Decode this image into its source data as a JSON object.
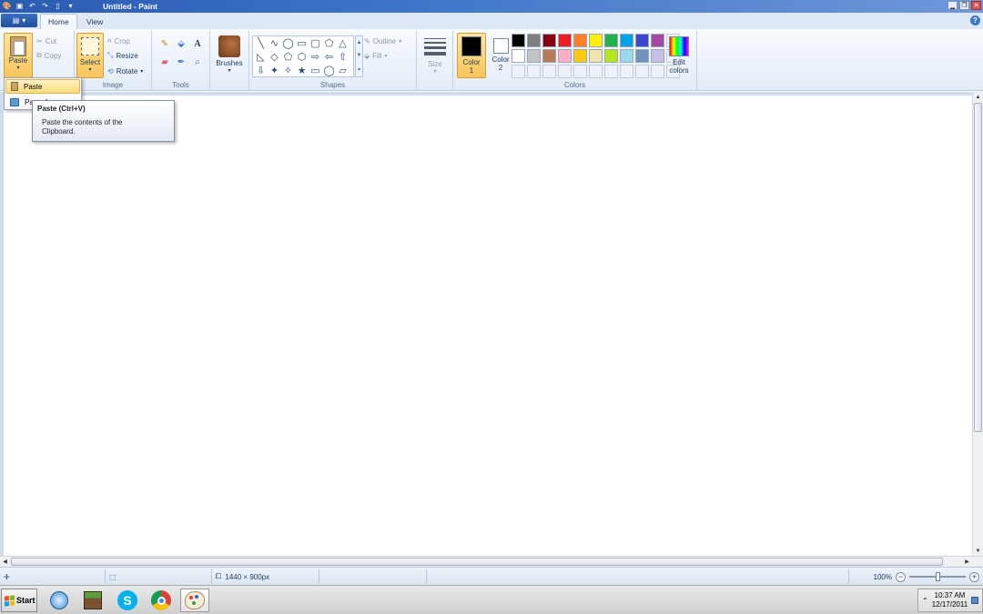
{
  "window": {
    "title": "Untitled - Paint",
    "controls": {
      "minimize": "▁",
      "restore": "❐",
      "close": "✕"
    }
  },
  "tabs": [
    {
      "label": "Home"
    },
    {
      "label": "View"
    }
  ],
  "help_label": "?",
  "ribbon": {
    "clipboard": {
      "paste": "Paste",
      "cut": "Cut",
      "copy": "Copy"
    },
    "image": {
      "label": "Image",
      "select": "Select",
      "crop": "Crop",
      "resize": "Resize",
      "rotate": "Rotate"
    },
    "tools": {
      "label": "Tools"
    },
    "brushes": {
      "label": "Brushes"
    },
    "shapes": {
      "label": "Shapes",
      "glyphs": [
        "╲",
        "∿",
        "◯",
        "▭",
        "▢",
        "⬠",
        "△",
        "◺",
        "◇",
        "⬠",
        "⬡",
        "⇨",
        "⇦",
        "⇧",
        "⇩",
        "✦",
        "✧",
        "★",
        "▭",
        "◯",
        "▱"
      ],
      "outline": "Outline",
      "fill": "Fill"
    },
    "size": {
      "label": "Size"
    },
    "colors": {
      "label": "Colors",
      "color1": {
        "line1": "Color",
        "line2": "1",
        "value": "#000000"
      },
      "color2": {
        "line1": "Color",
        "line2": "2",
        "value": "#ffffff"
      },
      "edit": {
        "line1": "Edit",
        "line2": "colors"
      },
      "palette_row1": [
        "#000000",
        "#7f7f7f",
        "#880015",
        "#ed1c24",
        "#ff7f27",
        "#fff200",
        "#22b14c",
        "#00a2e8",
        "#3f48cc",
        "#a349a4"
      ],
      "palette_row2": [
        "#ffffff",
        "#c3c3c3",
        "#b97a57",
        "#ffaec9",
        "#ffc90e",
        "#efe4b0",
        "#b5e61d",
        "#99d9ea",
        "#7092be",
        "#c8bfe7"
      ]
    }
  },
  "dropdown": {
    "items": [
      {
        "label": "Paste"
      },
      {
        "label": "Paste from"
      }
    ]
  },
  "tooltip": {
    "title": "Paste (Ctrl+V)",
    "body": "Paste the contents of the Clipboard."
  },
  "statusbar": {
    "canvas_size": "1440 × 900px",
    "zoom": "100%"
  },
  "taskbar": {
    "start": "Start",
    "time": "10:37 AM",
    "date": "12/17/2011"
  }
}
